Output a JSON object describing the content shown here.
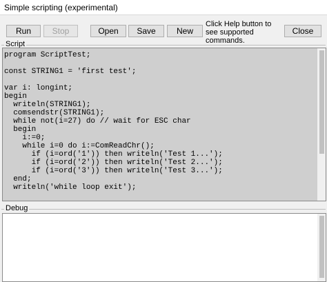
{
  "window": {
    "title": "Simple scripting (experimental)"
  },
  "toolbar": {
    "run_label": "Run",
    "stop_label": "Stop",
    "open_label": "Open",
    "save_label": "Save",
    "new_label": "New",
    "help_text": "Click Help button to see supported commands.",
    "close_label": "Close"
  },
  "script": {
    "label": "Script",
    "lines": [
      "program ScriptTest;",
      "",
      "const STRING1 = 'first test';",
      "",
      "var i: longint;",
      "begin",
      "  writeln(STRING1);",
      "  comsendstr(STRING1);",
      "  while not(i=27) do // wait for ESC char",
      "  begin",
      "    i:=0;",
      "    while i=0 do i:=ComReadChr();",
      "      if (i=ord('1')) then writeln('Test 1...');",
      "      if (i=ord('2')) then writeln('Test 2...');",
      "      if (i=ord('3')) then writeln('Test 3...');",
      "  end;",
      "  writeln('while loop exit');"
    ]
  },
  "debug": {
    "label": "Debug"
  }
}
